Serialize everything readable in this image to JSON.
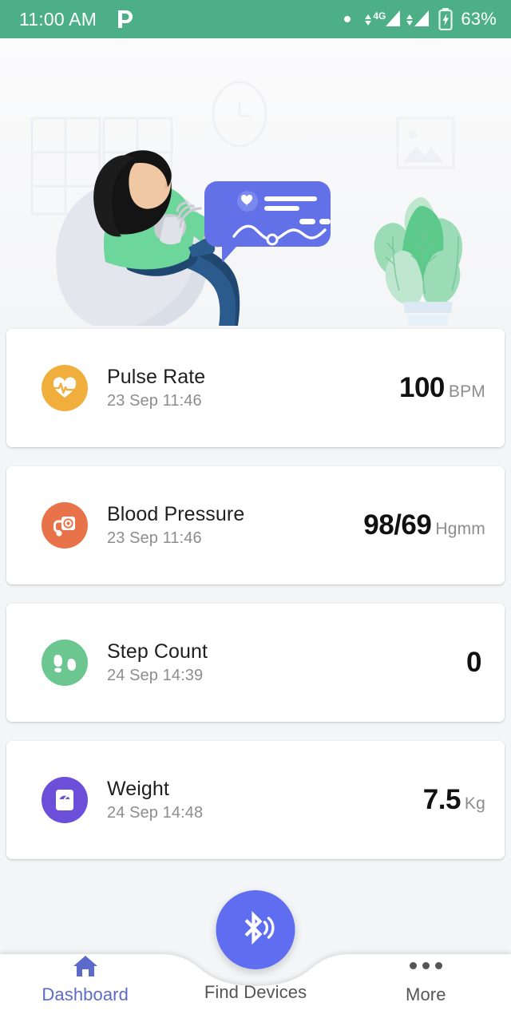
{
  "status_bar": {
    "time": "11:00 AM",
    "app_logo": "p-logo-icon",
    "notification_dot": "notification-dot-icon",
    "network_type": "4G",
    "signal_icon": "signal-bars-icon",
    "data_arrows_icon": "data-transfer-arrows-icon",
    "battery_icon": "battery-charging-icon",
    "battery_percent": "63%",
    "background_color": "#4caf87"
  },
  "hero": {
    "illustration_name": "woman-measuring-blood-pressure-illustration",
    "elements": [
      "window",
      "wall-clock",
      "picture-frame",
      "beanbag-chair",
      "woman-with-bp-cuff",
      "chat-bubble-chart",
      "potted-plant"
    ],
    "accent_color": "#6271e8"
  },
  "metrics": [
    {
      "id": "pulse-rate",
      "title": "Pulse Rate",
      "timestamp": "23 Sep 11:46",
      "value": "100",
      "unit": "BPM",
      "icon": "heart-pulse-icon",
      "icon_color": "#f0ae3c"
    },
    {
      "id": "blood-pressure",
      "title": "Blood Pressure",
      "timestamp": "23 Sep 11:46",
      "value": "98/69",
      "unit": "Hgmm",
      "icon": "blood-pressure-monitor-icon",
      "icon_color": "#e8734a"
    },
    {
      "id": "step-count",
      "title": "Step Count",
      "timestamp": "24 Sep 14:39",
      "value": "0",
      "unit": "",
      "icon": "footsteps-icon",
      "icon_color": "#6cc68f"
    },
    {
      "id": "weight",
      "title": "Weight",
      "timestamp": "24 Sep 14:48",
      "value": "7.5",
      "unit": "Kg",
      "icon": "weight-scale-icon",
      "icon_color": "#6b4fd8"
    }
  ],
  "bottom_nav": {
    "items": [
      {
        "id": "dashboard",
        "label": "Dashboard",
        "icon": "home-icon",
        "active": true
      },
      {
        "id": "find-devices",
        "label": "Find Devices",
        "icon": "bluetooth-searching-icon",
        "active": false
      },
      {
        "id": "more",
        "label": "More",
        "icon": "more-dots-icon",
        "active": false
      }
    ],
    "active_color": "#5c6bc9",
    "inactive_color": "#555555",
    "fab": {
      "name": "bluetooth-scan-fab",
      "icon": "bluetooth-searching-icon",
      "color": "#5f6ef0"
    }
  }
}
